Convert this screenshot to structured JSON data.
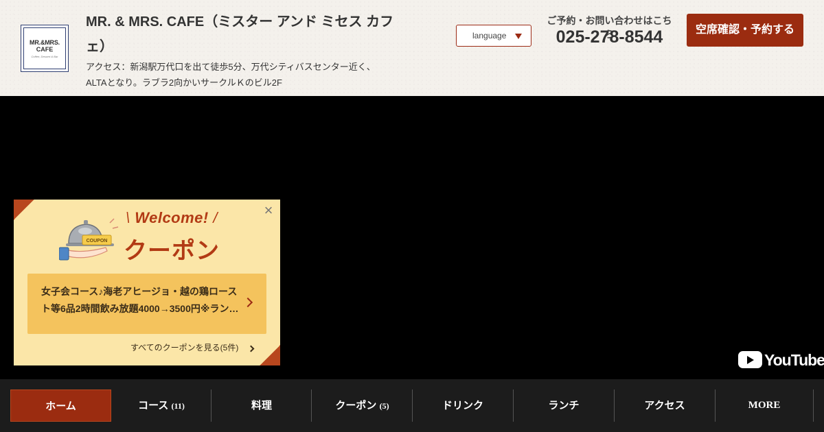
{
  "header": {
    "logo": {
      "line1": "MR.&MRS.",
      "line2": "CAFE",
      "line3": "Coffee, Dessert & Bar"
    },
    "shop_name": "MR. & MRS. CAFE（ミスター アンド ミセス カフェ）",
    "access": "アクセス：新潟駅万代口を出て徒歩5分、万代シティバスセンター近く、ALTAとなり。ラブラ2向かいサークルＫのビル2F",
    "language_label": "language",
    "tel_label": "ご予約・お問い合わせはこちら",
    "tel_number": "025-278-8544",
    "reserve_label": "空席確認・予約する"
  },
  "video": {
    "youtube_label": "YouTube"
  },
  "coupon_popup": {
    "welcome": "Welcome!",
    "title": "クーポン",
    "badge_text": "COUPON",
    "item_text": "女子会コース♪海老アヒージョ・越の鶏ロースト等6品2時間飲み放題4000→3500円※ラン…",
    "more_link": "すべてのクーポンを見る(5件)",
    "close_symbol": "×"
  },
  "nav": {
    "items": [
      {
        "label": "ホーム",
        "count": ""
      },
      {
        "label": "コース",
        "count": "(11)"
      },
      {
        "label": "料理",
        "count": ""
      },
      {
        "label": "クーポン",
        "count": "(5)"
      },
      {
        "label": "ドリンク",
        "count": ""
      },
      {
        "label": "ランチ",
        "count": ""
      },
      {
        "label": "アクセス",
        "count": ""
      },
      {
        "label": "MORE",
        "count": ""
      }
    ]
  },
  "colors": {
    "accent": "#9b2c10",
    "coupon_bg": "#fbe6a8",
    "coupon_item_bg": "#f4c35d",
    "nav_bg": "#1c1c1c"
  }
}
